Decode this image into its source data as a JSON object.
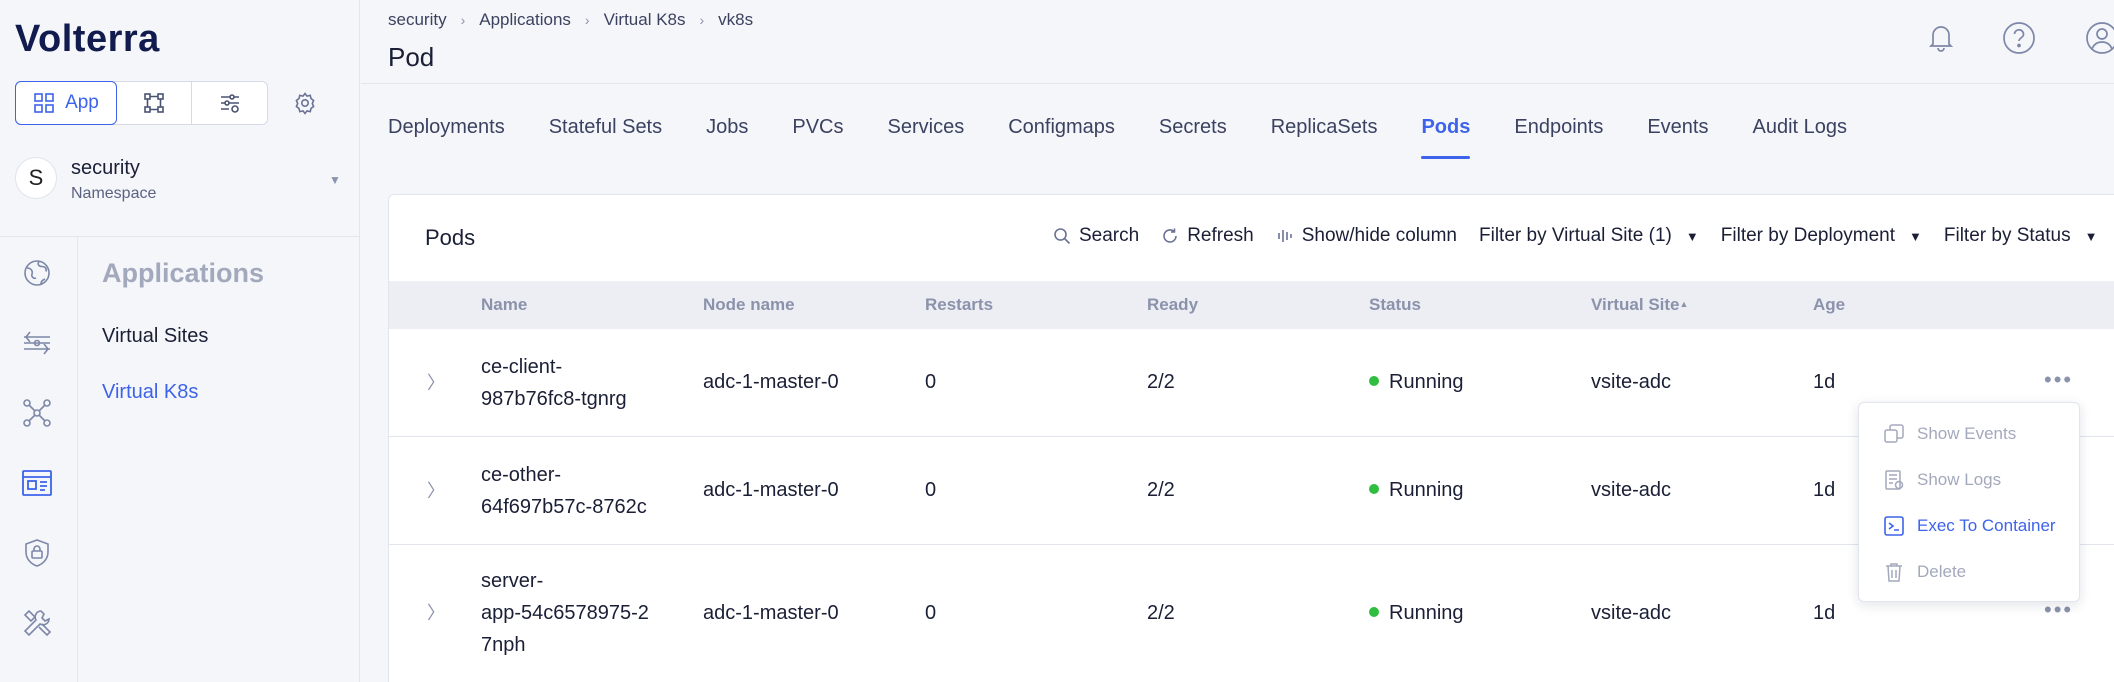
{
  "app": {
    "logo_text": "Volterra"
  },
  "sidebar": {
    "modes": [
      {
        "label": "App",
        "icon": "grid-icon"
      },
      {
        "label": "",
        "icon": "nodes-icon"
      },
      {
        "label": "",
        "icon": "filter-settings-icon"
      }
    ],
    "namespace": {
      "avatar": "S",
      "name": "security",
      "label": "Namespace"
    },
    "rail_icons": [
      "globe-icon",
      "network-flow-icon",
      "topology-icon",
      "dashboard-icon",
      "shield-lock-icon",
      "tools-icon"
    ],
    "section_title": "Applications",
    "items": [
      {
        "label": "Virtual Sites",
        "active": false
      },
      {
        "label": "Virtual K8s",
        "active": true
      }
    ]
  },
  "header": {
    "breadcrumbs": [
      "security",
      "Applications",
      "Virtual K8s",
      "vk8s"
    ],
    "title": "Pod"
  },
  "tabs": [
    "Deployments",
    "Stateful Sets",
    "Jobs",
    "PVCs",
    "Services",
    "Configmaps",
    "Secrets",
    "ReplicaSets",
    "Pods",
    "Endpoints",
    "Events",
    "Audit Logs"
  ],
  "active_tab": "Pods",
  "card": {
    "title": "Pods",
    "toolbar": {
      "search": "Search",
      "refresh": "Refresh",
      "columns": "Show/hide column",
      "filter_site": "Filter by Virtual Site (1)",
      "filter_deployment": "Filter by Deployment",
      "filter_status": "Filter by Status"
    },
    "columns": [
      "Name",
      "Node name",
      "Restarts",
      "Ready",
      "Status",
      "Virtual Site",
      "Age"
    ],
    "sorted_column": "Virtual Site",
    "rows": [
      {
        "name_lines": [
          "ce-client-",
          "987b76fc8-tgnrg"
        ],
        "node": "adc-1-master-0",
        "restarts": "0",
        "ready": "2/2",
        "status": "Running",
        "site": "vsite-adc",
        "age": "1d"
      },
      {
        "name_lines": [
          "ce-other-",
          "64f697b57c-8762c"
        ],
        "node": "adc-1-master-0",
        "restarts": "0",
        "ready": "2/2",
        "status": "Running",
        "site": "vsite-adc",
        "age": "1d"
      },
      {
        "name_lines": [
          "server-",
          "app-54c6578975-2",
          "7nph"
        ],
        "node": "adc-1-master-0",
        "restarts": "0",
        "ready": "2/2",
        "status": "Running",
        "site": "vsite-adc",
        "age": "1d"
      }
    ]
  },
  "context_menu": {
    "items": [
      {
        "label": "Show Events",
        "icon": "events-icon",
        "enabled": false
      },
      {
        "label": "Show Logs",
        "icon": "logs-icon",
        "enabled": false
      },
      {
        "label": "Exec To Container",
        "icon": "terminal-icon",
        "enabled": true
      },
      {
        "label": "Delete",
        "icon": "trash-icon",
        "enabled": false
      }
    ]
  },
  "colors": {
    "accent": "#3d63ea",
    "status_running": "#2fbe3f"
  }
}
